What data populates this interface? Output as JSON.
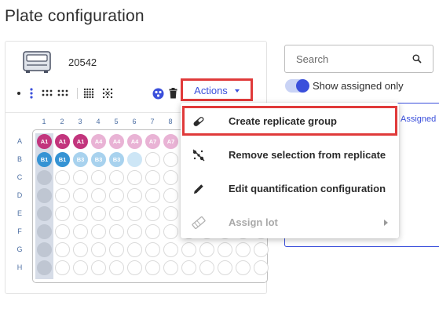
{
  "page": {
    "title": "Plate configuration"
  },
  "plate": {
    "id": "20542",
    "columns": [
      "1",
      "2",
      "3",
      "4",
      "5",
      "6",
      "7",
      "8"
    ],
    "rows": [
      "A",
      "B",
      "C",
      "D",
      "E",
      "F",
      "G",
      "H"
    ],
    "wells": [
      {
        "row": 0,
        "col": 0,
        "label": "A1",
        "style": "dark-pink"
      },
      {
        "row": 0,
        "col": 1,
        "label": "A1",
        "style": "dark-pink"
      },
      {
        "row": 0,
        "col": 2,
        "label": "A1",
        "style": "dark-pink"
      },
      {
        "row": 0,
        "col": 3,
        "label": "A4",
        "style": "light-pink"
      },
      {
        "row": 0,
        "col": 4,
        "label": "A4",
        "style": "light-pink"
      },
      {
        "row": 0,
        "col": 5,
        "label": "A4",
        "style": "light-pink"
      },
      {
        "row": 0,
        "col": 6,
        "label": "A7",
        "style": "light-pink"
      },
      {
        "row": 0,
        "col": 7,
        "label": "A7",
        "style": "light-pink"
      },
      {
        "row": 1,
        "col": 0,
        "label": "B1",
        "style": "dark-blue"
      },
      {
        "row": 1,
        "col": 1,
        "label": "B1",
        "style": "dark-blue"
      },
      {
        "row": 1,
        "col": 2,
        "label": "B3",
        "style": "light-blue"
      },
      {
        "row": 1,
        "col": 3,
        "label": "B3",
        "style": "light-blue"
      },
      {
        "row": 1,
        "col": 4,
        "label": "B3",
        "style": "light-blue"
      },
      {
        "row": 1,
        "col": 5,
        "label": "",
        "style": "pale-blue"
      }
    ]
  },
  "toolbar": {
    "view_icons": [
      "single-well-view-icon",
      "column-view-icon",
      "row-view-icon",
      "quadrant-view-icon",
      "block-selection-icon",
      "deselect-icon"
    ],
    "actions_label": "Actions"
  },
  "actions_menu": {
    "items": [
      {
        "label": "Create replicate group",
        "icon": "pill-link-icon",
        "enabled": true
      },
      {
        "label": "Remove selection from replicate",
        "icon": "unlink-icon",
        "enabled": true
      },
      {
        "label": "Edit quantification configuration",
        "icon": "pencil-icon",
        "enabled": true
      },
      {
        "label": "Assign lot",
        "icon": "tag-icon",
        "enabled": false,
        "has_submenu": true
      }
    ]
  },
  "sidebar": {
    "search_placeholder": "Search",
    "show_assigned_label": "Show assigned only",
    "show_assigned_on": true,
    "tab_assigned": "Assigned"
  },
  "colors": {
    "accent": "#3a4fdb",
    "highlight": "#e03a3a",
    "dark-pink": "#c2357d",
    "light-pink": "#e9b3d5",
    "dark-blue": "#3593d4",
    "light-blue": "#a8d2ee",
    "pale-blue": "#cde6f6"
  }
}
